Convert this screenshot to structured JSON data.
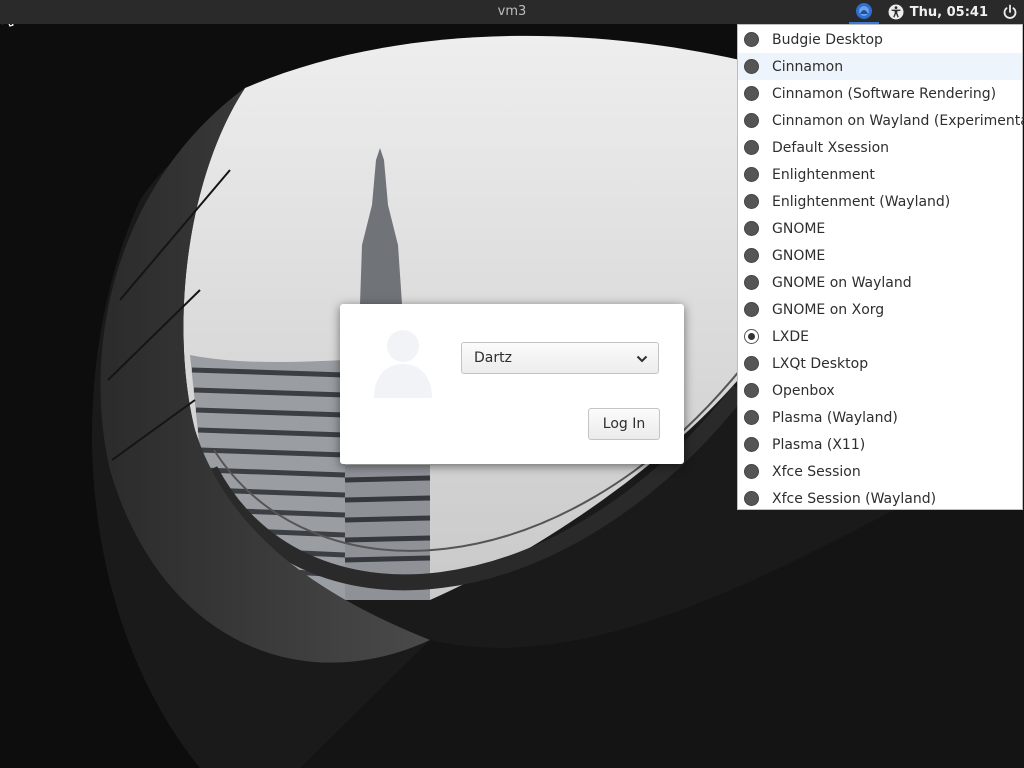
{
  "panel": {
    "hostname": "vm3",
    "clock": "Thu, 05:41",
    "accent_color": "#3b7bd1"
  },
  "login": {
    "selected_user": "Dartz",
    "login_label": "Log In"
  },
  "sessions": {
    "items": [
      {
        "label": "Budgie Desktop"
      },
      {
        "label": "Cinnamon"
      },
      {
        "label": "Cinnamon (Software Rendering)"
      },
      {
        "label": "Cinnamon on Wayland (Experimental)"
      },
      {
        "label": "Default Xsession"
      },
      {
        "label": "Enlightenment"
      },
      {
        "label": "Enlightenment (Wayland)"
      },
      {
        "label": "GNOME"
      },
      {
        "label": "GNOME"
      },
      {
        "label": "GNOME on Wayland"
      },
      {
        "label": "GNOME on Xorg"
      },
      {
        "label": "LXDE"
      },
      {
        "label": "LXQt Desktop"
      },
      {
        "label": "Openbox"
      },
      {
        "label": "Plasma (Wayland)"
      },
      {
        "label": "Plasma (X11)"
      },
      {
        "label": "Xfce Session"
      },
      {
        "label": "Xfce Session (Wayland)"
      }
    ],
    "selected_index": 11,
    "hover_index": 1
  },
  "icons": {
    "session_indicator": "session-icon",
    "accessibility": "accessibility-icon",
    "power": "power-icon",
    "avatar": "user-avatar-icon",
    "dropdown": "chevron-down-icon"
  }
}
